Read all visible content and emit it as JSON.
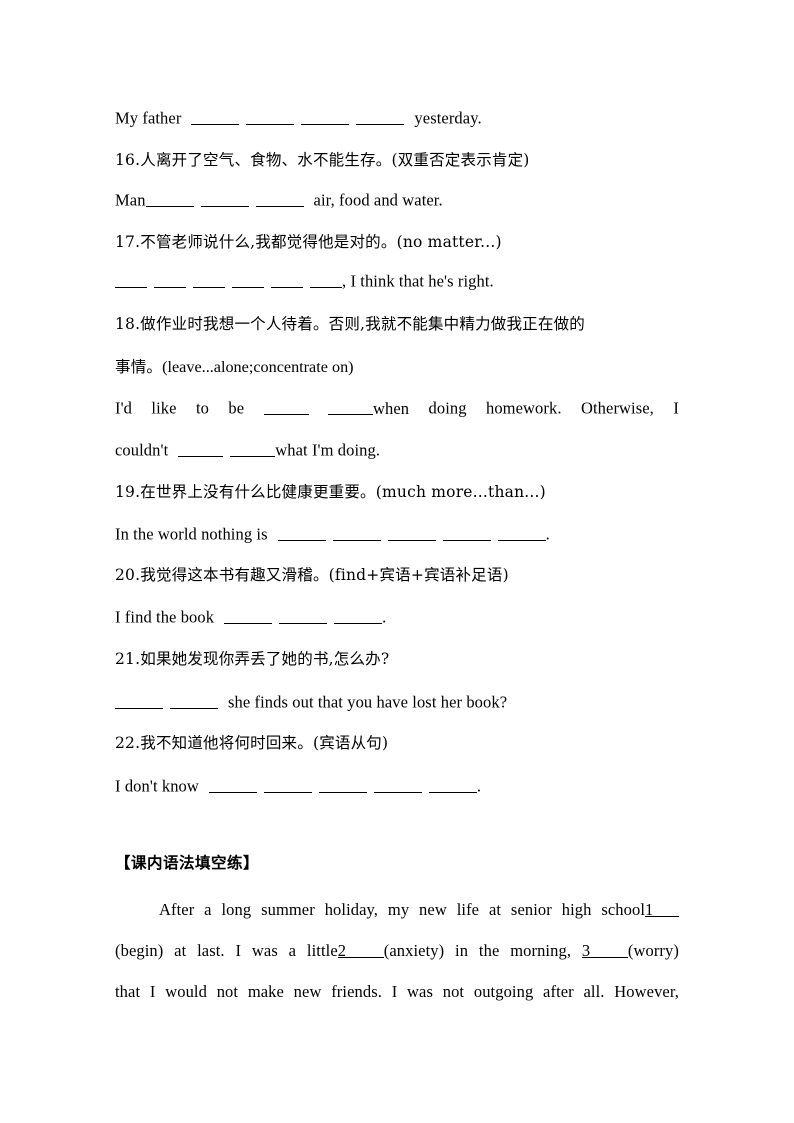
{
  "document": {
    "lines": {
      "l1_my_father": "My father",
      "l1_tail": "yesterday.",
      "l2_q16": "16.人离开了空气、食物、水不能生存。(双重否定表示肯定)",
      "l3_man": "Man",
      "l3_tail": "air, food and water.",
      "l4_q17": "17.不管老师说什么,我都觉得他是对的。(no matter...)",
      "l5_tail": ", I think that he's right.",
      "l6_q18a": "18.做作业时我想一个人待着。否则,我就不能集中精力做我正在做的",
      "l7_q18b_cn": "事情。",
      "l7_q18b_en": "(leave...alone;concentrate on)",
      "l8_a": "I'd",
      "l8_b": "like",
      "l8_c": "to",
      "l8_d": "be",
      "l8_e": "when",
      "l8_f": "doing",
      "l8_g": "homework.",
      "l8_h": "Otherwise,",
      "l8_i": "I",
      "l9_couldnt": "couldn't",
      "l9_tail": "what I'm doing.",
      "l10_q19": "19.在世界上没有什么比健康更重要。(much more...than...)",
      "l11_head": "In the world nothing is",
      "l11_period": ".",
      "l12_q20": "20.我觉得这本书有趣又滑稽。(find+宾语+宾语补足语)",
      "l13_head": "I find the book",
      "l13_period": ".",
      "l14_q21": "21.如果她发现你弄丢了她的书,怎么办?",
      "l15_tail": "she finds out that you have lost her book?",
      "l16_q22": "22.我不知道他将何时回来。(宾语从句)",
      "l17_head": "I don't know",
      "l17_period": ".",
      "section_header": "【课内语法填空练】",
      "p1_a": "After a long summer holiday, my new life at senior high school",
      "p1_blank1": "1",
      "p2_a": "(begin) at last. I was a little",
      "p2_blank2": "2",
      "p2_b": "(anxiety) in the morning,",
      "p2_blank3": "3",
      "p2_c": "(worry)",
      "p3_a": "that I would not make new friends. I was not outgoing after all. However,"
    }
  }
}
